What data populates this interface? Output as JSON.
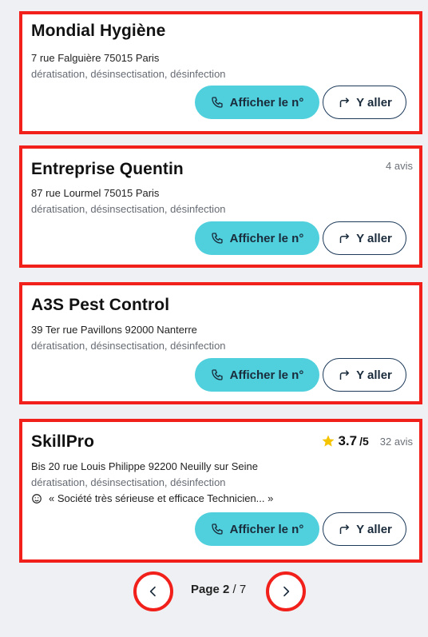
{
  "listings": [
    {
      "name": "Mondial Hygiène",
      "address": "7 rue Falguière 75015 Paris",
      "categories": "dératisation, désinsectisation, désinfection",
      "reviews": "",
      "rating": "",
      "rating_max": "",
      "quote": ""
    },
    {
      "name": "Entreprise Quentin",
      "address": "87 rue Lourmel 75015 Paris",
      "categories": "dératisation, désinsectisation, désinfection",
      "reviews": "4 avis",
      "rating": "",
      "rating_max": "",
      "quote": ""
    },
    {
      "name": "A3S Pest Control",
      "address": "39 Ter rue Pavillons 92000 Nanterre",
      "categories": "dératisation, désinsectisation, désinfection",
      "reviews": "",
      "rating": "",
      "rating_max": "",
      "quote": ""
    },
    {
      "name": "SkillPro",
      "address": "Bis 20 rue Louis Philippe 92200 Neuilly sur Seine",
      "categories": "dératisation, désinsectisation, désinfection",
      "reviews": "32 avis",
      "rating": "3.7",
      "rating_max": "/5",
      "quote": "« Société très sérieuse et efficace Technicien... »"
    }
  ],
  "buttons": {
    "phone_label": "Afficher le n°",
    "go_label": "Y aller"
  },
  "pagination": {
    "label": "Page",
    "current": "2",
    "total": "/ 7"
  },
  "colors": {
    "accent": "#4fd0dc",
    "highlight": "#f2201a",
    "star": "#f5c400"
  },
  "icons": {
    "phone": "phone-icon",
    "directions": "directions-icon",
    "prev": "chevron-left-icon",
    "next": "chevron-right-icon",
    "star": "star-icon",
    "quote": "smiley-icon"
  }
}
